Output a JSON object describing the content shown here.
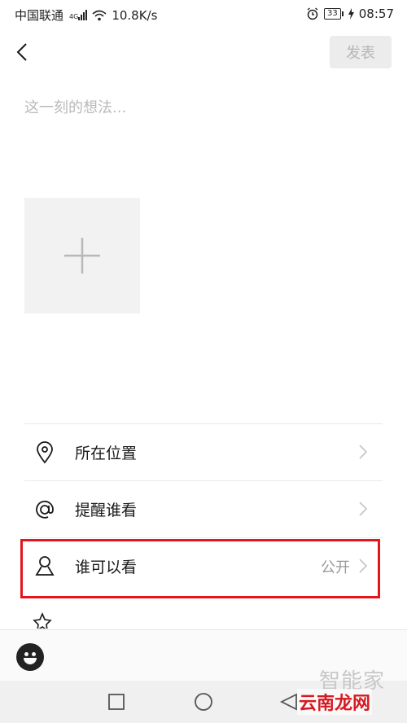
{
  "status_bar": {
    "carrier": "中国联通",
    "network_badge": "4G",
    "speed": "10.8K/s",
    "battery": "33",
    "time": "08:57"
  },
  "header": {
    "back_icon": "chevron-left-icon",
    "publish_label": "发表"
  },
  "compose": {
    "placeholder": "这一刻的想法..."
  },
  "options": [
    {
      "icon": "location-pin-icon",
      "label": "所在位置",
      "value": ""
    },
    {
      "icon": "at-icon",
      "label": "提醒谁看",
      "value": ""
    },
    {
      "icon": "person-icon",
      "label": "谁可以看",
      "value": "公开"
    }
  ],
  "colors": {
    "highlight": "#e3161c",
    "publish_bg": "#ececec",
    "publish_text": "#b5b5b5",
    "watermark_red": "#d71920"
  },
  "watermarks": {
    "top": "智能家",
    "bottom": "云南龙网"
  }
}
